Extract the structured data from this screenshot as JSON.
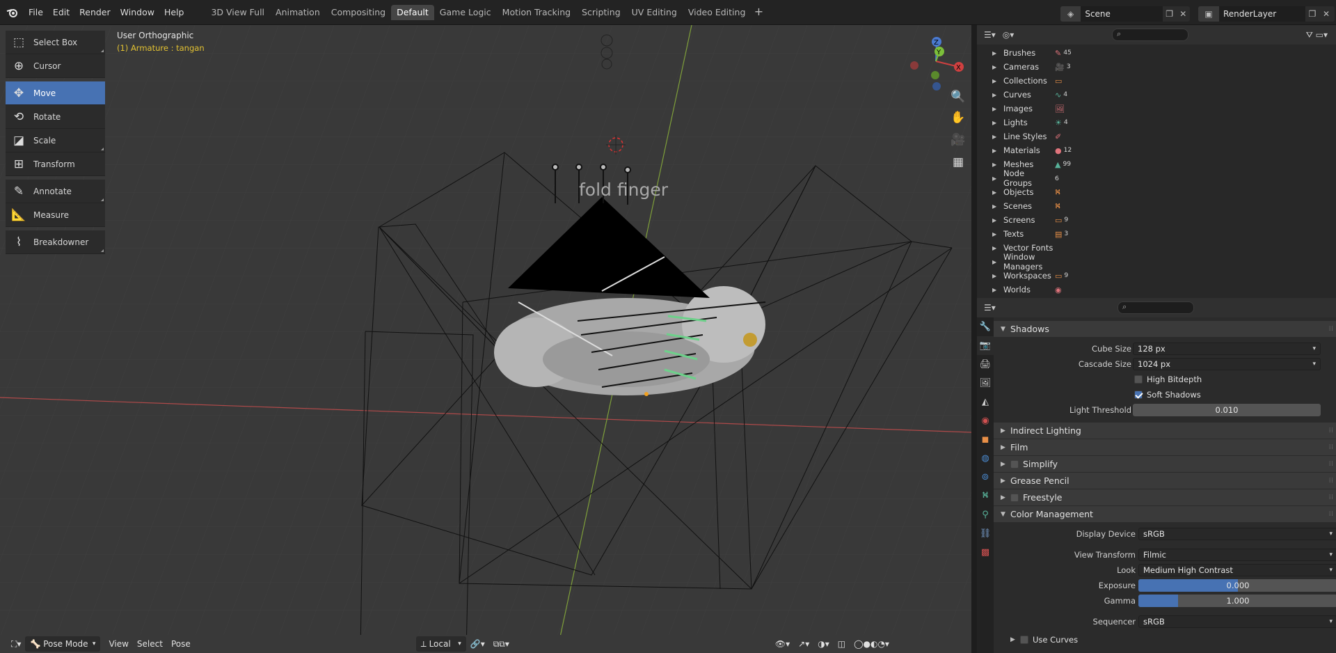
{
  "topbar": {
    "menus": [
      "File",
      "Edit",
      "Render",
      "Window",
      "Help"
    ],
    "tabs": [
      "3D View Full",
      "Animation",
      "Compositing",
      "Default",
      "Game Logic",
      "Motion Tracking",
      "Scripting",
      "UV Editing",
      "Video Editing"
    ],
    "active_tab": "Default",
    "add_tab": "+",
    "scene": "Scene",
    "render_layer": "RenderLayer"
  },
  "viewport": {
    "view_name": "User Orthographic",
    "object_info": "(1) Armature : tangan",
    "overlay_text": "fold finger",
    "axes": {
      "x": "X",
      "y": "Y",
      "z": "Z"
    },
    "tools": [
      {
        "label": "Select Box",
        "icon": "select-box-icon"
      },
      {
        "label": "Cursor",
        "icon": "cursor-icon"
      },
      {
        "label": "Move",
        "icon": "move-icon"
      },
      {
        "label": "Rotate",
        "icon": "rotate-icon"
      },
      {
        "label": "Scale",
        "icon": "scale-icon"
      },
      {
        "label": "Transform",
        "icon": "transform-icon"
      },
      {
        "label": "Annotate",
        "icon": "annotate-icon"
      },
      {
        "label": "Measure",
        "icon": "measure-icon"
      },
      {
        "label": "Breakdowner",
        "icon": "breakdowner-icon"
      }
    ],
    "active_tool": "Move",
    "bottom": {
      "mode": "Pose Mode",
      "view": "View",
      "select": "Select",
      "pose": "Pose",
      "pivot": "Local"
    }
  },
  "outliner": {
    "rows": [
      {
        "label": "Brushes",
        "count": "45"
      },
      {
        "label": "Cameras",
        "count": "3"
      },
      {
        "label": "Collections",
        "count": ""
      },
      {
        "label": "Curves",
        "count": "4"
      },
      {
        "label": "Images",
        "count": ""
      },
      {
        "label": "Lights",
        "count": "4"
      },
      {
        "label": "Line Styles",
        "count": ""
      },
      {
        "label": "Materials",
        "count": "12"
      },
      {
        "label": "Meshes",
        "count": "99"
      },
      {
        "label": "Node Groups",
        "count": "6"
      },
      {
        "label": "Objects",
        "count": ""
      },
      {
        "label": "Scenes",
        "count": ""
      },
      {
        "label": "Screens",
        "count": "9"
      },
      {
        "label": "Texts",
        "count": "3"
      },
      {
        "label": "Vector Fonts",
        "count": ""
      },
      {
        "label": "Window Managers",
        "count": ""
      },
      {
        "label": "Workspaces",
        "count": "9"
      },
      {
        "label": "Worlds",
        "count": ""
      }
    ]
  },
  "properties": {
    "shadows": {
      "title": "Shadows",
      "cube_size_label": "Cube Size",
      "cube_size": "128 px",
      "cascade_size_label": "Cascade Size",
      "cascade_size": "1024 px",
      "high_bitdepth": "High Bitdepth",
      "soft_shadows": "Soft Shadows",
      "light_threshold_label": "Light Threshold",
      "light_threshold": "0.010"
    },
    "panels": {
      "indirect": "Indirect Lighting",
      "film": "Film",
      "simplify": "Simplify",
      "grease": "Grease Pencil",
      "freestyle": "Freestyle"
    },
    "color_management": {
      "title": "Color Management",
      "display_device_label": "Display Device",
      "display_device": "sRGB",
      "view_transform_label": "View Transform",
      "view_transform": "Filmic",
      "look_label": "Look",
      "look": "Medium High Contrast",
      "exposure_label": "Exposure",
      "exposure": "0.000",
      "exposure_fill": 0.5,
      "gamma_label": "Gamma",
      "gamma": "1.000",
      "gamma_fill": 0.2,
      "sequencer_label": "Sequencer",
      "sequencer": "sRGB",
      "use_curves": "Use Curves"
    }
  }
}
